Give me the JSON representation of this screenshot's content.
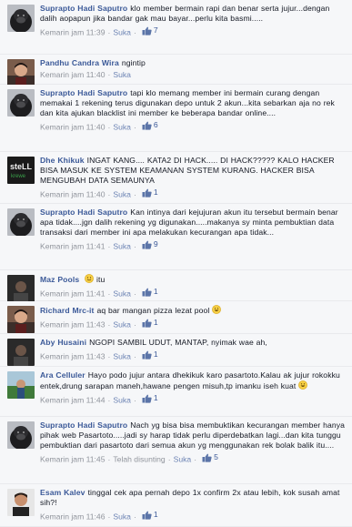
{
  "comments": [
    {
      "author": "Suprapto Hadi Saputro",
      "text": "klo member bermain rapi dan benar serta jujur...dengan dalih aopapun jika bandar gak mau bayar...perlu kita basmi.....",
      "time": "Kemarin jam 11:39",
      "like_label": "Suka",
      "likes": "7",
      "avatar_icon": "gorilla-avatar"
    },
    {
      "author": "Pandhu Candra Wira",
      "text": "ngintip",
      "time": "Kemarin jam 11:40",
      "like_label": "Suka",
      "avatar_icon": "person-avatar"
    },
    {
      "author": "Suprapto Hadi Saputro",
      "text": "tapi klo memang member ini bermain curang dengan memakai 1 rekening terus digunakan depo untuk 2 akun...kita sebarkan aja no rek dan kita ajukan blacklist ini member ke beberapa bandar online....",
      "time": "Kemarin jam 11:40",
      "like_label": "Suka",
      "likes": "6",
      "avatar_icon": "gorilla-avatar"
    },
    {
      "author": "Dhe Khikuk",
      "text": "INGAT KANG.... KATA2 DI HACK..... DI HACK????? KALO HACKER BISA MASUK KE SYSTEM KEAMANAN SYSTEM KURANG. HACKER BISA MENGUBAH DATA SEMAUNYA",
      "time": "Kemarin jam 11:40",
      "like_label": "Suka",
      "likes": "1",
      "avatar_icon": "logo-avatar"
    },
    {
      "author": "Suprapto Hadi Saputro",
      "text": "Kan intinya dari kejujuran akun itu tersebut bermain benar apa tidak....jgn dalih rekening yg digunakan.....makanya sy minta pembuktian data transaksi dari member ini apa melakukan kecurangan apa tidak...",
      "time": "Kemarin jam 11:41",
      "like_label": "Suka",
      "likes": "9",
      "avatar_icon": "gorilla-avatar"
    },
    {
      "author": "Maz Pools",
      "text": "itu",
      "time": "Kemarin jam 11:41",
      "like_label": "Suka",
      "likes": "1",
      "avatar_icon": "dark-avatar",
      "emoticon": "smile-emoticon",
      "emoticon_before_text": true
    },
    {
      "author": "Richard Mrc-it",
      "text": "aq bar mangan pizza lezat pool",
      "time": "Kemarin jam 11:43",
      "like_label": "Suka",
      "likes": "1",
      "avatar_icon": "person-avatar",
      "emoticon": "grin-emoticon"
    },
    {
      "author": "Aby Husaini",
      "text": "NGOPI SAMBIL UDUT, MANTAP, nyimak wae ah,",
      "time": "Kemarin jam 11:43",
      "like_label": "Suka",
      "likes": "1",
      "avatar_icon": "dark-avatar"
    },
    {
      "author": "Ara Celluler",
      "text": "Hayo podo jujur antara dhekikuk karo pasartoto.Kalau ak jujur rokokku entek,drung sarapan maneh,hawane pengen misuh,tp imanku iseh kuat",
      "time": "Kemarin jam 11:44",
      "like_label": "Suka",
      "likes": "1",
      "avatar_icon": "landscape-avatar",
      "emoticon": "grin-emoticon"
    },
    {
      "author": "Suprapto Hadi Saputro",
      "text": "Nach yg bisa bisa membuktikan kecurangan member hanya pihak web Pasartoto.....jadi sy harap tidak perlu diperdebatkan lagi...dan kita tunggu pembuktian dari pasartoto dari semua akun yg menggunakan rek bolak balik itu....",
      "time": "Kemarin jam 11:45",
      "hidden_label": "Telah disunting",
      "like_label": "Suka",
      "likes": "5",
      "avatar_icon": "gorilla-avatar"
    },
    {
      "author": "Esam Kalev",
      "text": "tinggal cek apa pernah depo 1x confirm 2x atau lebih, kok susah amat sih?!",
      "time": "Kemarin jam 11:46",
      "like_label": "Suka",
      "likes": "1",
      "avatar_icon": "portrait-avatar"
    }
  ]
}
